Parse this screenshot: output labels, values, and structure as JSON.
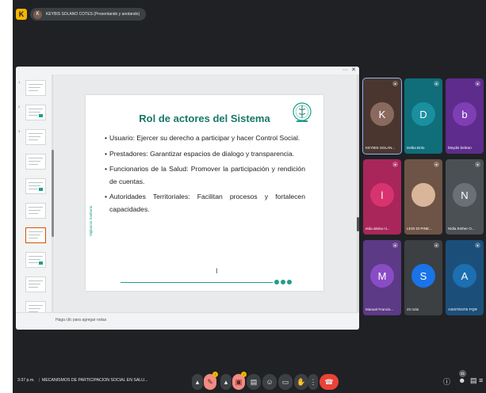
{
  "window": {
    "app_logo": "K",
    "presenter_avatar": "K",
    "presenter_label": "KEYBIS SOLANO COTES (Presentando y anotando)"
  },
  "presentation": {
    "titlebar_more": "···",
    "titlebar_close": "✕",
    "thumbnails": [
      "1",
      "2",
      "3",
      "",
      "",
      "",
      "",
      "",
      "",
      "",
      ""
    ],
    "selected_thumbnail_index": 6,
    "slide": {
      "title": "Rol de actores del Sistema",
      "bullets": [
        "Usuario: Ejercer su derecho a participar y hacer Control Social.",
        "Prestadores: Garantizar espacios de dialogo y transparencia.",
        "Funcionarios de la Salud: Promover la participación y rendición de cuentas.",
        "Autoridades Territoriales: Facilitan procesos y fortalecen capacidades."
      ],
      "vertical_text": "Vigilancia Sanitaria",
      "text_cursor": "I"
    },
    "notes_placeholder": "Haga clic para agregar notas"
  },
  "participants": [
    {
      "name": "KEYBIS SOLAN...",
      "initial": "K",
      "avatar_color": "#8a6a5e",
      "tile_color": "#4a362f",
      "highlighted": true
    },
    {
      "name": "Delka Brito",
      "initial": "D",
      "avatar_color": "#1a8fa0",
      "tile_color": "#0f6e7a"
    },
    {
      "name": "bleydis beltran",
      "initial": "b",
      "avatar_color": "#7e3fb5",
      "tile_color": "#5e2c8c"
    },
    {
      "name": "elda alsina ni...",
      "initial": "l",
      "avatar_color": "#d8336f",
      "tile_color": "#a8265a"
    },
    {
      "name": "LEDI DI PINE...",
      "initial": "",
      "avatar_color": "#d9b69a",
      "tile_color": "#6e5446"
    },
    {
      "name": "Nidia Esther O...",
      "initial": "N",
      "avatar_color": "#6b7076",
      "tile_color": "#4b5054"
    },
    {
      "name": "Manuel Francis...",
      "initial": "M",
      "avatar_color": "#8a4cc4",
      "tile_color": "#5c3a86"
    },
    {
      "name": "23 más",
      "initial": "S",
      "avatar_color": "#1a73e8",
      "tile_color": "#3c4043"
    },
    {
      "name": "ASISTENTE PQR",
      "initial": "A",
      "avatar_color": "#1c6fb0",
      "tile_color": "#1b4f7a"
    }
  ],
  "bottom_bar": {
    "time": "3:37 p.m.",
    "divider": "|",
    "meeting_name": "MECANISMOS DE PARTICIPACION SOCIAL EN SALU...",
    "controls": [
      {
        "name": "more-mic-options",
        "glyph": "▴",
        "style": "dark"
      },
      {
        "name": "mic",
        "glyph": "✎",
        "style": "pink"
      },
      {
        "name": "more-cam-options",
        "glyph": "▴",
        "style": "dark"
      },
      {
        "name": "camera",
        "glyph": "▣",
        "style": "pink"
      },
      {
        "name": "captions",
        "glyph": "▤",
        "style": "dark"
      },
      {
        "name": "emoji",
        "glyph": "☺",
        "style": "dark"
      },
      {
        "name": "present",
        "glyph": "▭",
        "style": "dark"
      },
      {
        "name": "raise-hand",
        "glyph": "✋",
        "style": "dark"
      },
      {
        "name": "more-options",
        "glyph": "⋮",
        "style": "dark"
      },
      {
        "name": "leave-call",
        "glyph": "☎",
        "style": "red"
      }
    ],
    "right_icons": [
      {
        "name": "info",
        "glyph": "ⓘ"
      },
      {
        "name": "people",
        "glyph": "☻"
      },
      {
        "name": "chat",
        "glyph": "▤"
      },
      {
        "name": "activities",
        "glyph": "≡"
      }
    ],
    "people_count": "31"
  }
}
